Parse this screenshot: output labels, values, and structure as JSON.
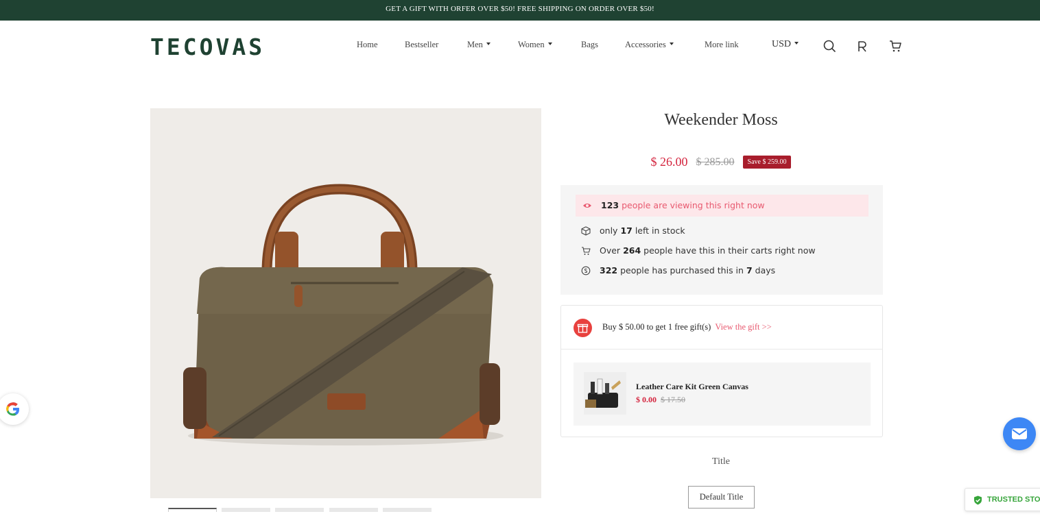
{
  "announcement": "GET A GIFT WITH ORFER OVER $50! FREE SHIPPING ON ORDER OVER $50!",
  "brand": "TECOVAS",
  "nav": {
    "home": "Home",
    "bestseller": "Bestseller",
    "men": "Men",
    "women": "Women",
    "bags": "Bags",
    "accessories": "Accessories",
    "more": "More link"
  },
  "currency": "USD",
  "header_icons": [
    "search-icon",
    "account-icon",
    "cart-icon"
  ],
  "product": {
    "title": "Weekender Moss",
    "price": "$ 26.00",
    "compare_price": "$ 285.00",
    "save": "Save $ 259.00",
    "image_thumbnails": 5
  },
  "stats": {
    "viewing_count": "123",
    "viewing_text": "people are viewing this right now",
    "stock_pre": "only",
    "stock_count": "17",
    "stock_post": "left in stock",
    "carts_pre": "Over",
    "carts_count": "264",
    "carts_post": "people have this in their carts right now",
    "purchased_count": "322",
    "purchased_mid": "people has purchased this in",
    "purchased_days": "7",
    "purchased_post": "days"
  },
  "gift": {
    "text": "Buy $ 50.00 to get 1 free gift(s)",
    "link": "View the gift  >>",
    "item_name": "Leather Care Kit Green Canvas",
    "item_price": "$ 0.00",
    "item_compare": "$ 17.50"
  },
  "option": {
    "label": "Title",
    "value": "Default Title"
  },
  "widgets": {
    "trusted": "TRUSTED STORE"
  },
  "colors": {
    "brand_green": "#1f4232",
    "sale_red": "#d4243e",
    "badge_red": "#a81d2c",
    "pink_text": "#e8596f",
    "chat_blue": "#3d87f5",
    "trusted_green": "#37a53b"
  }
}
